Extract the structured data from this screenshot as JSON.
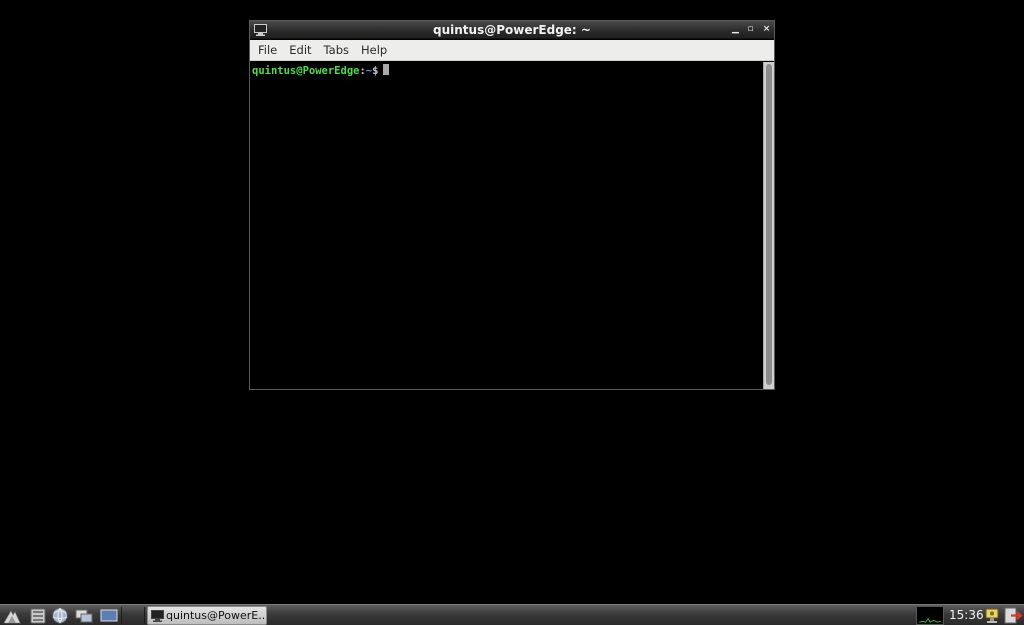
{
  "window": {
    "title": "quintus@PowerEdge: ~",
    "controls": {
      "minimize": "▁",
      "maximize": "▫",
      "close": "×"
    },
    "icon": "terminal-icon"
  },
  "menubar": {
    "items": [
      {
        "label": "File"
      },
      {
        "label": "Edit"
      },
      {
        "label": "Tabs"
      },
      {
        "label": "Help"
      }
    ]
  },
  "terminal": {
    "prompt_user": "quintus@PowerEdge",
    "prompt_sep": ":",
    "prompt_path": "~",
    "prompt_symbol": "$",
    "colors": {
      "user": "#4fdc4f",
      "path": "#6b8ff2"
    }
  },
  "taskbar": {
    "launchers": [
      {
        "name": "menu-icon"
      },
      {
        "name": "file-manager-icon"
      },
      {
        "name": "web-browser-icon"
      },
      {
        "name": "window-switcher-icon"
      },
      {
        "name": "show-desktop-icon"
      }
    ],
    "task": {
      "label": "quintus@PowerE...",
      "icon": "terminal-icon"
    },
    "clock": "15:36",
    "tray": [
      "network-icon",
      "logout-icon"
    ]
  }
}
